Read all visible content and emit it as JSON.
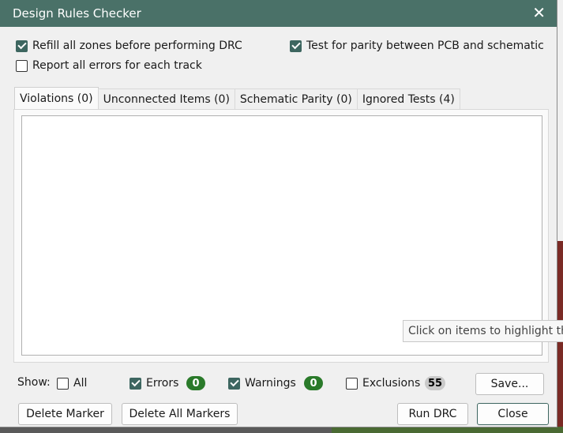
{
  "window": {
    "title": "Design Rules Checker"
  },
  "options": {
    "refill_zones": "Refill all zones before performing DRC",
    "test_parity": "Test for parity between PCB and schematic",
    "report_all_errors": "Report all errors for each track"
  },
  "tabs": [
    {
      "label": "Violations (0)"
    },
    {
      "label": "Unconnected Items (0)"
    },
    {
      "label": "Schematic Parity (0)"
    },
    {
      "label": "Ignored Tests (4)"
    }
  ],
  "tooltip": "Click on items to highlight them",
  "show": {
    "label": "Show:",
    "all": "All",
    "errors": "Errors",
    "errors_count": "0",
    "warnings": "Warnings",
    "warnings_count": "0",
    "exclusions": "Exclusions",
    "exclusions_count": "55"
  },
  "buttons": {
    "save": "Save...",
    "delete_marker": "Delete Marker",
    "delete_all_markers": "Delete All Markers",
    "run_drc": "Run DRC",
    "close": "Close"
  },
  "colors": {
    "titlebar": "#4a7168",
    "accent": "#3d6660",
    "badge_green": "#2a7a2a",
    "badge_gray": "#c9c9c9"
  }
}
